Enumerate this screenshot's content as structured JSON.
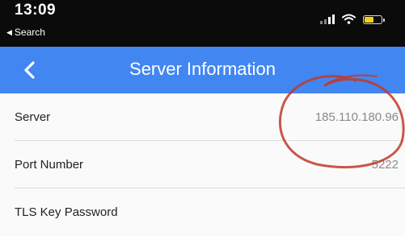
{
  "status_bar": {
    "time": "13:09",
    "back_app": "Search",
    "icons": [
      "cellular-signal-icon",
      "wifi-icon",
      "battery-icon"
    ],
    "battery_color": "#f2d21b"
  },
  "nav": {
    "title": "Server Information",
    "back_icon": "chevron-left-icon",
    "background": "#4286f2"
  },
  "rows": [
    {
      "label": "Server",
      "value": "185.110.180.96"
    },
    {
      "label": "Port Number",
      "value": "5222"
    },
    {
      "label": "TLS Key Password",
      "value": ""
    }
  ],
  "annotation_color": "#c0392b"
}
